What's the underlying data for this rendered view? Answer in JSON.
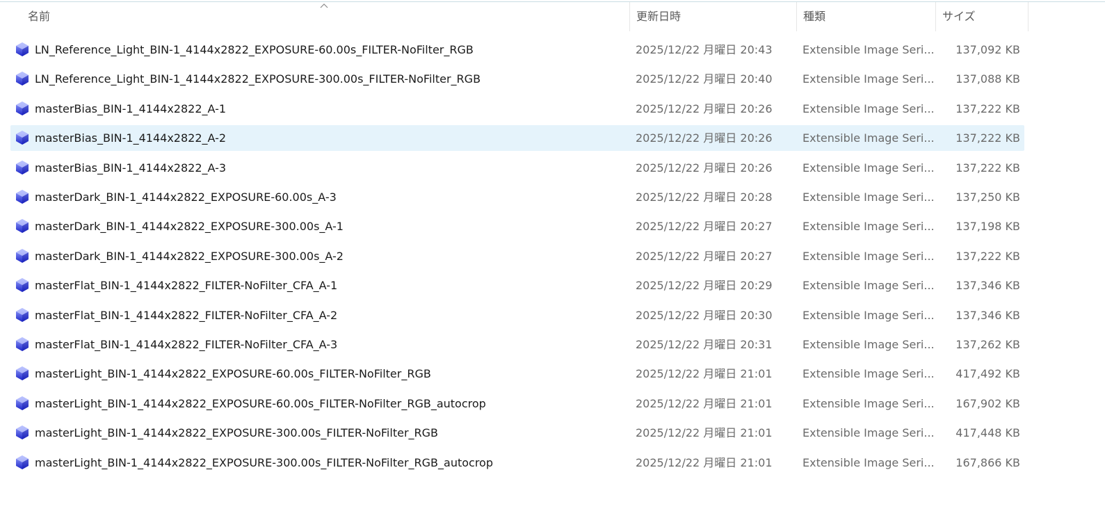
{
  "columns": {
    "name": "名前",
    "date": "更新日時",
    "type": "種類",
    "size": "サイズ"
  },
  "sort": {
    "column": "name",
    "direction": "ascending"
  },
  "selected_index": 3,
  "colors": {
    "selection": "#e5f3fb",
    "icon_top": "#9aa6ff",
    "icon_bottom": "#1c25c8"
  },
  "files": [
    {
      "name": "LN_Reference_Light_BIN-1_4144x2822_EXPOSURE-60.00s_FILTER-NoFilter_RGB",
      "date": "2025/12/22 月曜日 20:43",
      "type": "Extensible Image Seri...",
      "size": "137,092 KB",
      "icon": "xisf-file-icon"
    },
    {
      "name": "LN_Reference_Light_BIN-1_4144x2822_EXPOSURE-300.00s_FILTER-NoFilter_RGB",
      "date": "2025/12/22 月曜日 20:40",
      "type": "Extensible Image Seri...",
      "size": "137,088 KB",
      "icon": "xisf-file-icon"
    },
    {
      "name": "masterBias_BIN-1_4144x2822_A-1",
      "date": "2025/12/22 月曜日 20:26",
      "type": "Extensible Image Seri...",
      "size": "137,222 KB",
      "icon": "xisf-file-icon"
    },
    {
      "name": "masterBias_BIN-1_4144x2822_A-2",
      "date": "2025/12/22 月曜日 20:26",
      "type": "Extensible Image Seri...",
      "size": "137,222 KB",
      "icon": "xisf-file-icon"
    },
    {
      "name": "masterBias_BIN-1_4144x2822_A-3",
      "date": "2025/12/22 月曜日 20:26",
      "type": "Extensible Image Seri...",
      "size": "137,222 KB",
      "icon": "xisf-file-icon"
    },
    {
      "name": "masterDark_BIN-1_4144x2822_EXPOSURE-60.00s_A-3",
      "date": "2025/12/22 月曜日 20:28",
      "type": "Extensible Image Seri...",
      "size": "137,250 KB",
      "icon": "xisf-file-icon"
    },
    {
      "name": "masterDark_BIN-1_4144x2822_EXPOSURE-300.00s_A-1",
      "date": "2025/12/22 月曜日 20:27",
      "type": "Extensible Image Seri...",
      "size": "137,198 KB",
      "icon": "xisf-file-icon"
    },
    {
      "name": "masterDark_BIN-1_4144x2822_EXPOSURE-300.00s_A-2",
      "date": "2025/12/22 月曜日 20:27",
      "type": "Extensible Image Seri...",
      "size": "137,222 KB",
      "icon": "xisf-file-icon"
    },
    {
      "name": "masterFlat_BIN-1_4144x2822_FILTER-NoFilter_CFA_A-1",
      "date": "2025/12/22 月曜日 20:29",
      "type": "Extensible Image Seri...",
      "size": "137,346 KB",
      "icon": "xisf-file-icon"
    },
    {
      "name": "masterFlat_BIN-1_4144x2822_FILTER-NoFilter_CFA_A-2",
      "date": "2025/12/22 月曜日 20:30",
      "type": "Extensible Image Seri...",
      "size": "137,346 KB",
      "icon": "xisf-file-icon"
    },
    {
      "name": "masterFlat_BIN-1_4144x2822_FILTER-NoFilter_CFA_A-3",
      "date": "2025/12/22 月曜日 20:31",
      "type": "Extensible Image Seri...",
      "size": "137,262 KB",
      "icon": "xisf-file-icon"
    },
    {
      "name": "masterLight_BIN-1_4144x2822_EXPOSURE-60.00s_FILTER-NoFilter_RGB",
      "date": "2025/12/22 月曜日 21:01",
      "type": "Extensible Image Seri...",
      "size": "417,492 KB",
      "icon": "xisf-file-icon"
    },
    {
      "name": "masterLight_BIN-1_4144x2822_EXPOSURE-60.00s_FILTER-NoFilter_RGB_autocrop",
      "date": "2025/12/22 月曜日 21:01",
      "type": "Extensible Image Seri...",
      "size": "167,902 KB",
      "icon": "xisf-file-icon"
    },
    {
      "name": "masterLight_BIN-1_4144x2822_EXPOSURE-300.00s_FILTER-NoFilter_RGB",
      "date": "2025/12/22 月曜日 21:01",
      "type": "Extensible Image Seri...",
      "size": "417,448 KB",
      "icon": "xisf-file-icon"
    },
    {
      "name": "masterLight_BIN-1_4144x2822_EXPOSURE-300.00s_FILTER-NoFilter_RGB_autocrop",
      "date": "2025/12/22 月曜日 21:01",
      "type": "Extensible Image Seri...",
      "size": "167,866 KB",
      "icon": "xisf-file-icon"
    }
  ]
}
